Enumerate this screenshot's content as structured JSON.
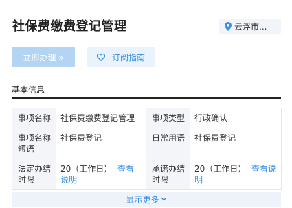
{
  "page": {
    "title": "社保费缴费登记管理"
  },
  "location": {
    "label": "云浮市..."
  },
  "actions": {
    "apply_label": "立即办理 »",
    "subscribe_label": "订阅指南"
  },
  "section": {
    "title": "基本信息"
  },
  "info_table": {
    "row1": {
      "k1": "事项名称",
      "v1": "社保费缴费登记管理",
      "k2": "事项类型",
      "v2": "行政确认"
    },
    "row2": {
      "k1": "事项名称短语",
      "v1": "社保费登记",
      "k2": "日常用语",
      "v2": "社保费登记"
    },
    "row3": {
      "k1": "法定办结时限",
      "v1": "20（工作日）",
      "v1_link": "查看说明",
      "k2": "承诺办结时限",
      "v2": "20（工作日）",
      "v2_link": "查看说明"
    }
  },
  "show_more": {
    "label": "显示更多"
  },
  "colors": {
    "accent": "#3a8ee6",
    "apply_bg": "#b3d4f3",
    "subscribe_bg": "#eaf3fc"
  },
  "icons": {
    "location": "map-pin-icon",
    "subscribe": "heart-icon",
    "more": "chevron-down-icon"
  }
}
